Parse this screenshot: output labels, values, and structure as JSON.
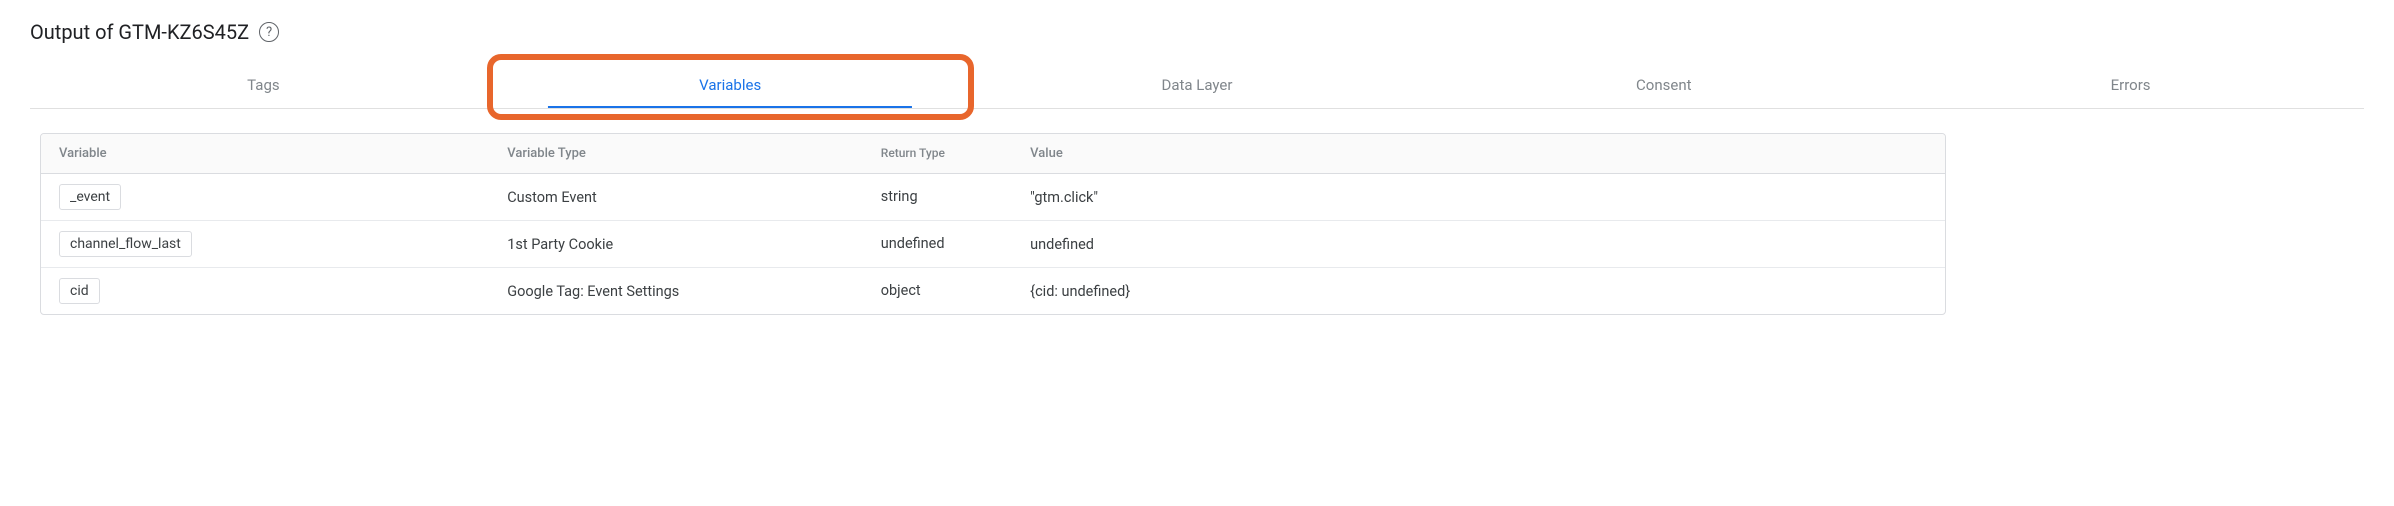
{
  "header": {
    "title": "Output of GTM-KZ6S45Z"
  },
  "tabs": [
    {
      "label": "Tags",
      "active": false
    },
    {
      "label": "Variables",
      "active": true
    },
    {
      "label": "Data Layer",
      "active": false
    },
    {
      "label": "Consent",
      "active": false
    },
    {
      "label": "Errors",
      "active": false
    }
  ],
  "table": {
    "headers": {
      "variable": "Variable",
      "type": "Variable Type",
      "return": "Return Type",
      "value": "Value"
    },
    "rows": [
      {
        "variable": "_event",
        "type": "Custom Event",
        "return": "string",
        "value": "\"gtm.click\""
      },
      {
        "variable": "channel_flow_last",
        "type": "1st Party Cookie",
        "return": "undefined",
        "value": "undefined"
      },
      {
        "variable": "cid",
        "type": "Google Tag: Event Settings",
        "return": "object",
        "value": "{cid: undefined}"
      }
    ]
  },
  "annotation": {
    "highlight_tab_index": 1,
    "color": "#e8662c"
  }
}
